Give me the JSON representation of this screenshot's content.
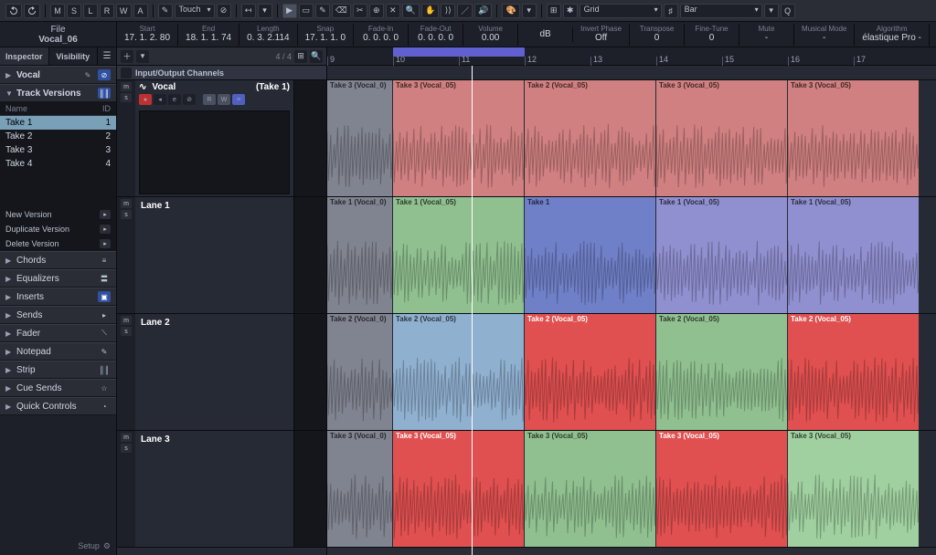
{
  "toolbar": {
    "buttons": [
      "M",
      "S",
      "L",
      "R",
      "W",
      "A"
    ],
    "automation_mode": "Touch",
    "snap_mode": "Grid",
    "quantize": "Bar"
  },
  "info": {
    "track_name": "Vocal_06",
    "fields": [
      {
        "lbl": "File",
        "val": ""
      },
      {
        "lbl": "Start",
        "val": "17. 1. 2. 80"
      },
      {
        "lbl": "End",
        "val": "18. 1. 1. 74"
      },
      {
        "lbl": "Length",
        "val": "0. 3. 2.114"
      },
      {
        "lbl": "Snap",
        "val": "17. 1. 1. 0"
      },
      {
        "lbl": "Fade-In",
        "val": "0. 0. 0. 0"
      },
      {
        "lbl": "Fade-Out",
        "val": "0. 0. 0. 0"
      },
      {
        "lbl": "Volume",
        "val": "0.00"
      },
      {
        "lbl": "",
        "val": "dB"
      },
      {
        "lbl": "Invert Phase",
        "val": "Off"
      },
      {
        "lbl": "Transpose",
        "val": "0"
      },
      {
        "lbl": "Fine-Tune",
        "val": "0"
      },
      {
        "lbl": "Mute",
        "val": "-"
      },
      {
        "lbl": "Musical Mode",
        "val": "-"
      },
      {
        "lbl": "Algorithm",
        "val": "élastique Pro -"
      }
    ]
  },
  "inspector": {
    "tabs": [
      "Inspector",
      "Visibility"
    ],
    "track": "Vocal",
    "section": "Track Versions",
    "ver_head": [
      "Name",
      "ID"
    ],
    "versions": [
      {
        "name": "Take 1",
        "id": "1",
        "sel": true
      },
      {
        "name": "Take 2",
        "id": "2"
      },
      {
        "name": "Take 3",
        "id": "3"
      },
      {
        "name": "Take 4",
        "id": "4"
      }
    ],
    "actions": [
      "New Version",
      "Duplicate Version",
      "Delete Version"
    ],
    "sections": [
      "Chords",
      "Equalizers",
      "Inserts",
      "Sends",
      "Fader",
      "Notepad",
      "Strip",
      "Cue Sends",
      "Quick Controls"
    ],
    "setup": "Setup"
  },
  "track_col": {
    "count": "4 / 4",
    "io": "Input/Output Channels",
    "track_name": "Vocal",
    "take": "(Take 1)",
    "lanes": [
      "Lane 1",
      "Lane 2",
      "Lane 3"
    ]
  },
  "ruler": {
    "bars": [
      9,
      10,
      11,
      12,
      13,
      14,
      15,
      16,
      17
    ],
    "loop": [
      10,
      12
    ],
    "playhead": 11.2
  },
  "clips": {
    "row0": [
      {
        "lbl": "Take 3 (Vocal_0)",
        "cls": "gray",
        "s": 9,
        "e": 10
      },
      {
        "lbl": "Take 3 (Vocal_05)",
        "cls": "red",
        "s": 10,
        "e": 12
      },
      {
        "lbl": "Take 2 (Vocal_05)",
        "cls": "red",
        "s": 12,
        "e": 14
      },
      {
        "lbl": "Take 3 (Vocal_05)",
        "cls": "red",
        "s": 14,
        "e": 16
      },
      {
        "lbl": "Take 3 (Vocal_05)",
        "cls": "red",
        "s": 16,
        "e": 18
      }
    ],
    "row1": [
      {
        "lbl": "Take 1 (Vocal_0)",
        "cls": "gray",
        "s": 9,
        "e": 10
      },
      {
        "lbl": "Take 1 (Vocal_05)",
        "cls": "green",
        "s": 10,
        "e": 12
      },
      {
        "lbl": "Take 1",
        "cls": "blue bright",
        "s": 12,
        "e": 14
      },
      {
        "lbl": "Take 1 (Vocal_05)",
        "cls": "blue",
        "s": 14,
        "e": 16
      },
      {
        "lbl": "Take 1 (Vocal_05)",
        "cls": "blue",
        "s": 16,
        "e": 18
      }
    ],
    "row2": [
      {
        "lbl": "Take 2 (Vocal_0)",
        "cls": "gray",
        "s": 9,
        "e": 10
      },
      {
        "lbl": "Take 2 (Vocal_05)",
        "cls": "lblue",
        "s": 10,
        "e": 12
      },
      {
        "lbl": "Take 2 (Vocal_05)",
        "cls": "red bright",
        "s": 12,
        "e": 14
      },
      {
        "lbl": "Take 2 (Vocal_05)",
        "cls": "green",
        "s": 14,
        "e": 16
      },
      {
        "lbl": "Take 2 (Vocal_05)",
        "cls": "red bright",
        "s": 16,
        "e": 18
      }
    ],
    "row3": [
      {
        "lbl": "Take 3 (Vocal_0)",
        "cls": "gray",
        "s": 9,
        "e": 10
      },
      {
        "lbl": "Take 3 (Vocal_05)",
        "cls": "red bright",
        "s": 10,
        "e": 12
      },
      {
        "lbl": "Take 3 (Vocal_05)",
        "cls": "green",
        "s": 12,
        "e": 14
      },
      {
        "lbl": "Take 3 (Vocal_05)",
        "cls": "red bright",
        "s": 14,
        "e": 16
      },
      {
        "lbl": "Take 3 (Vocal_05)",
        "cls": "green bright",
        "s": 16,
        "e": 18
      }
    ]
  }
}
